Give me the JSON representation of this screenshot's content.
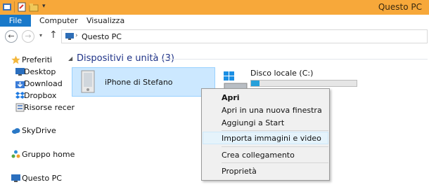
{
  "window": {
    "title": "Questo PC"
  },
  "ribbon": {
    "tabs": [
      "File",
      "Computer",
      "Visualizza"
    ]
  },
  "address": {
    "path": "Questo PC"
  },
  "sidebar": {
    "favorites_label": "Preferiti",
    "favorites": [
      "Desktop",
      "Download",
      "Dropbox",
      "Risorse recer"
    ],
    "skydrive_label": "SkyDrive",
    "homegroup_label": "Gruppo home",
    "thispc_label": "Questo PC"
  },
  "main": {
    "section_title": "Dispositivi e unità (3)",
    "devices": [
      {
        "name": "iPhone di Stefano"
      },
      {
        "name": "Disco locale (C:)",
        "usage_fraction": 0.08
      }
    ]
  },
  "context_menu": {
    "items": [
      "Apri",
      "Apri in una nuova finestra",
      "Aggiungi a Start",
      "Importa immagini e video",
      "Crea collegamento",
      "Proprietà"
    ],
    "highlighted": "Importa immagini e video"
  },
  "colors": {
    "title_bar": "#f7a83a",
    "file_tab": "#1979ca",
    "selection": "#cce8ff",
    "section_title": "#1e3287",
    "drive_bar": "#26a0da"
  }
}
